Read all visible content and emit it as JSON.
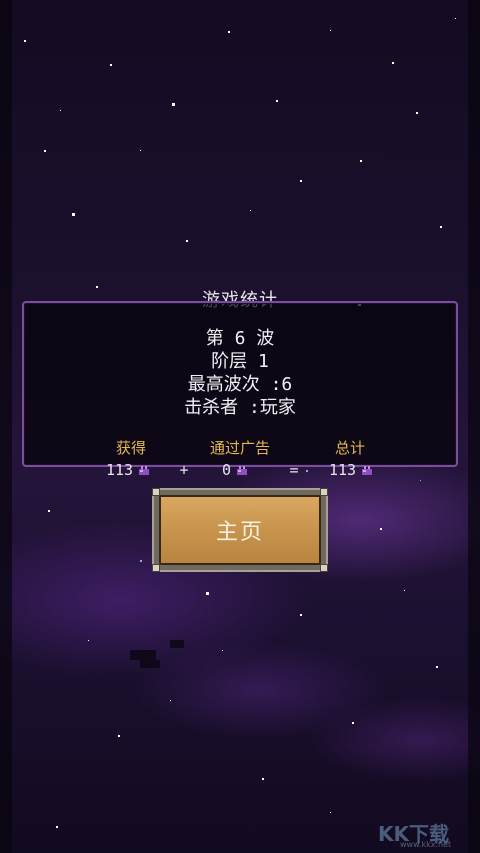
{
  "stats": {
    "title": "游戏统计",
    "wave": "第 6 波",
    "floor": "阶层 1",
    "max_wave": "最高波次 :6",
    "killer": "击杀者 :玩家"
  },
  "rewards": {
    "earned_label": "获得",
    "ads_label": "通过广告",
    "total_label": "总计",
    "earned_value": "113",
    "ads_value": "0",
    "total_value": "113",
    "plus_sign": "+",
    "equals_sign": "=",
    "currency_icon": "purple-gem-icon"
  },
  "home_button": {
    "label": "主页"
  },
  "watermark": {
    "text": "KK下载",
    "url": "www.kkx.net"
  },
  "colors": {
    "panel_border": "#7a4f9a",
    "label_gold": "#e2b94a",
    "button_gold": "#c9954f",
    "gem_purple": "#b06ad8"
  }
}
